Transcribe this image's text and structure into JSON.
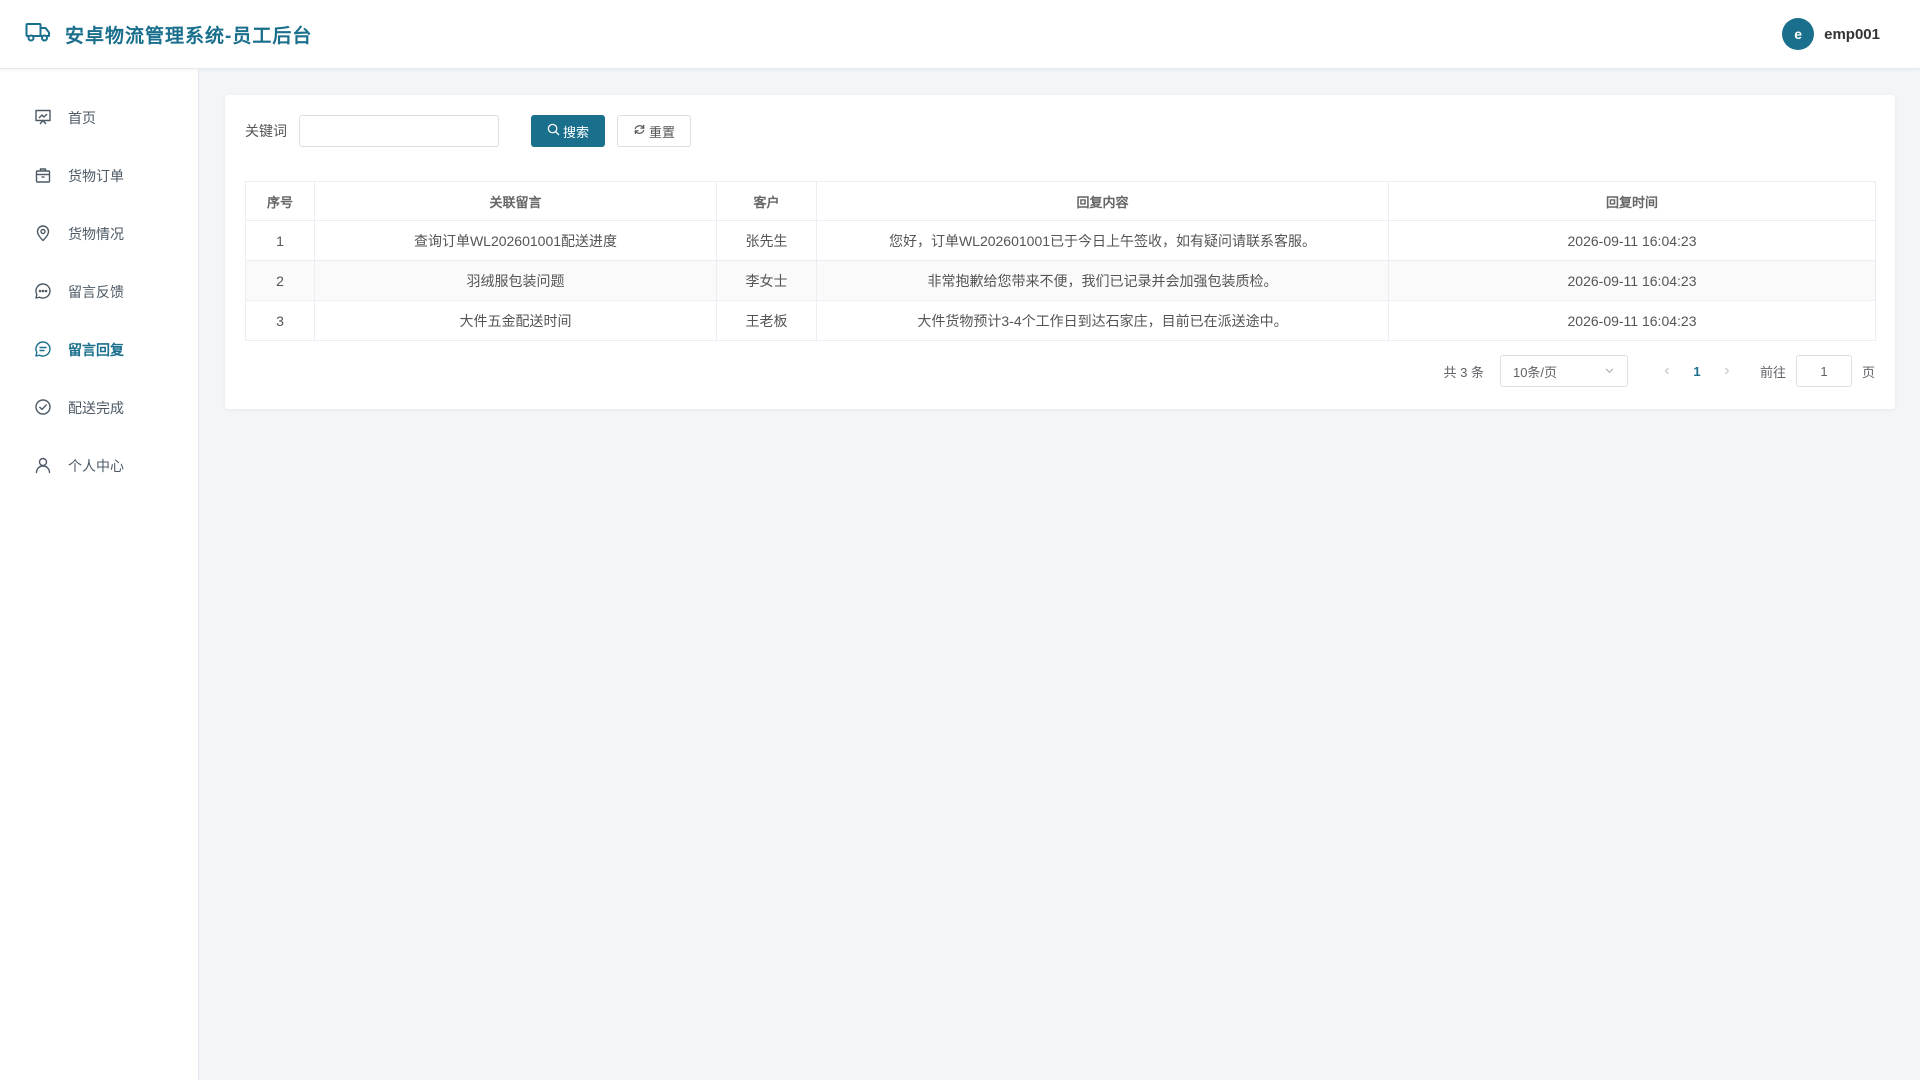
{
  "header": {
    "title": "安卓物流管理系统-员工后台",
    "brand_icon": "truck-icon",
    "avatar_letter": "e",
    "username": "emp001",
    "accent_color": "#1a6f8c"
  },
  "sidebar": {
    "items": [
      {
        "label": "首页",
        "icon": "presentation-icon",
        "active": false
      },
      {
        "label": "货物订单",
        "icon": "package-icon",
        "active": false
      },
      {
        "label": "货物情况",
        "icon": "location-pin-icon",
        "active": false
      },
      {
        "label": "留言反馈",
        "icon": "chat-dots-icon",
        "active": false
      },
      {
        "label": "留言回复",
        "icon": "chat-lines-icon",
        "active": true
      },
      {
        "label": "配送完成",
        "icon": "check-circle-icon",
        "active": false
      },
      {
        "label": "个人中心",
        "icon": "user-icon",
        "active": false
      }
    ]
  },
  "search": {
    "label": "关键词",
    "value": "",
    "placeholder": "",
    "search_label": "搜索",
    "reset_label": "重置"
  },
  "table": {
    "headers": [
      "序号",
      "关联留言",
      "客户",
      "回复内容",
      "回复时间"
    ],
    "rows": [
      [
        "1",
        "查询订单WL202601001配送进度",
        "张先生",
        "您好，订单WL202601001已于今日上午签收，如有疑问请联系客服。",
        "2026-09-11 16:04:23"
      ],
      [
        "2",
        "羽绒服包装问题",
        "李女士",
        "非常抱歉给您带来不便，我们已记录并会加强包装质检。",
        "2026-09-11 16:04:23"
      ],
      [
        "3",
        "大件五金配送时间",
        "王老板",
        "大件货物预计3-4个工作日到达石家庄，目前已在派送途中。",
        "2026-09-11 16:04:23"
      ]
    ]
  },
  "pagination": {
    "total_text": "共 3 条",
    "page_size": "10条/页",
    "current_page": "1",
    "goto_label": "前往",
    "goto_value": "1",
    "goto_suffix": "页"
  }
}
